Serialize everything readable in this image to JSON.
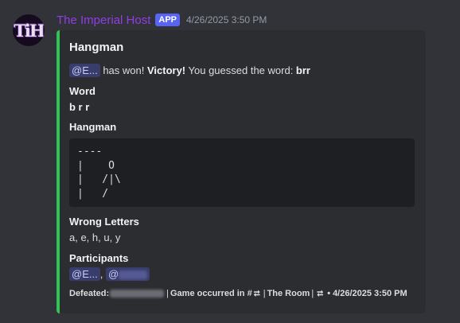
{
  "message": {
    "avatar_text": "TiH",
    "username": "The Imperial Host",
    "badge": "APP",
    "timestamp": "4/26/2025 3:50 PM",
    "username_color": "#8f3ee0",
    "accent_color": "#2dc653"
  },
  "embed": {
    "title": "Hangman",
    "description": {
      "mention": "@E...",
      "text1": " has won! ",
      "victory": "Victory!",
      "text2": " You guessed the word: ",
      "word": "brr"
    },
    "fields": {
      "word": {
        "name": "Word",
        "value": "b r r"
      },
      "hangman": {
        "name": "Hangman",
        "lines": [
          "----",
          "|    O",
          "|   /|\\",
          "|   /"
        ]
      },
      "wrong_letters": {
        "name": "Wrong Letters",
        "value": "a, e, h, u, y"
      },
      "participants": {
        "name": "Participants",
        "mention1": "@E...",
        "separator": ", ",
        "mention2": "@"
      }
    },
    "footer": {
      "defeated_label": "Defeated:",
      "game_text": "Game occurred in #",
      "room": "The Room",
      "time_sep": "•",
      "time": "4/26/2025 3:50 PM"
    }
  }
}
